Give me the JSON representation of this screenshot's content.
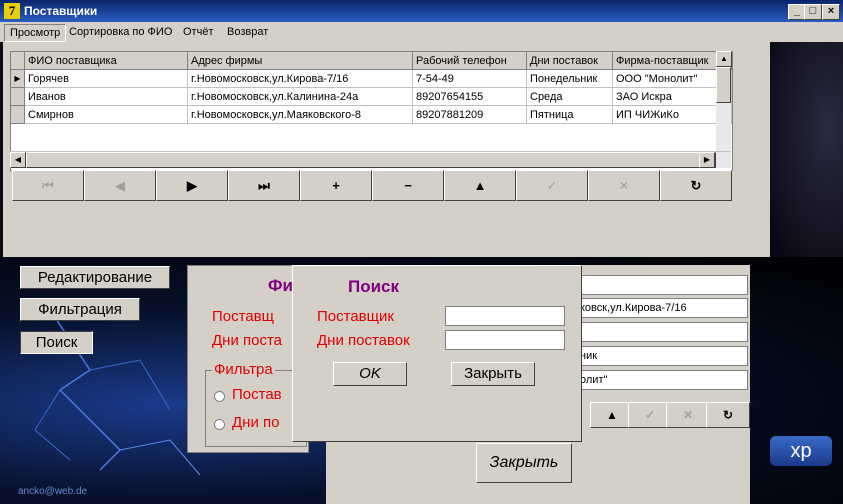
{
  "window": {
    "title": "Поставщики",
    "controls": [
      "_",
      "□",
      "×"
    ]
  },
  "menu": [
    "Просмотр",
    "Сортировка по ФИО",
    "Отчёт",
    "Возврат"
  ],
  "grid": {
    "columns": [
      "ФИО поставщика",
      "Адрес фирмы",
      "Рабочий телефон",
      "Дни поставок",
      "Фирма-поставщик"
    ],
    "rows": [
      [
        "Горячев",
        "г.Новомосковск,ул.Кирова-7/16",
        "7-54-49",
        "Понедельник",
        "ООО \"Монолит\""
      ],
      [
        "Иванов",
        "г.Новомосковск,ул.Калинина-24а",
        "89207654155",
        "Среда",
        "ЗАО Искра"
      ],
      [
        "Смирнов",
        "г.Новомосковск,ул.Маяковского-8",
        "89207881209",
        "Пятница",
        "ИП ЧИЖиКо"
      ]
    ]
  },
  "navigator": {
    "buttons": [
      {
        "glyph": "⏮",
        "enabled": false
      },
      {
        "glyph": "◀",
        "enabled": false
      },
      {
        "glyph": "▶",
        "enabled": true
      },
      {
        "glyph": "⏭",
        "enabled": true
      },
      {
        "glyph": "+",
        "enabled": true
      },
      {
        "glyph": "−",
        "enabled": true
      },
      {
        "glyph": "▲",
        "enabled": true
      },
      {
        "glyph": "✓",
        "enabled": false
      },
      {
        "glyph": "✕",
        "enabled": false
      },
      {
        "glyph": "↻",
        "enabled": true
      }
    ]
  },
  "side_buttons": [
    "Редактирование",
    "Фильтрация",
    "Поиск"
  ],
  "edit_form": {
    "fields": [
      "",
      "ковск,ул.Кирова-7/16",
      "",
      "ник",
      "олит\""
    ],
    "small_nav": [
      {
        "glyph": "▲",
        "enabled": true
      },
      {
        "glyph": "✓",
        "enabled": false
      },
      {
        "glyph": "✕",
        "enabled": false
      },
      {
        "glyph": "↻",
        "enabled": true
      }
    ],
    "close_label": "Закрыть"
  },
  "filter_dialog": {
    "title_partial": "Фи",
    "labels": [
      "Поставщ",
      "Дни поста"
    ],
    "group_title": "Фильтра",
    "radios": [
      "Постав",
      "Дни по"
    ]
  },
  "search_dialog": {
    "title": "Поиск",
    "label_supplier": "Поставщик",
    "label_days": "Дни поставок",
    "ok": "OK",
    "close": "Закрыть"
  },
  "decor": {
    "xp_badge": "xp",
    "email": "ancko@web.de"
  },
  "colors": {
    "title_bar": "#0a246a",
    "label_red": "#e00000",
    "title_purple": "#800080",
    "face": "#d4d0c8"
  }
}
